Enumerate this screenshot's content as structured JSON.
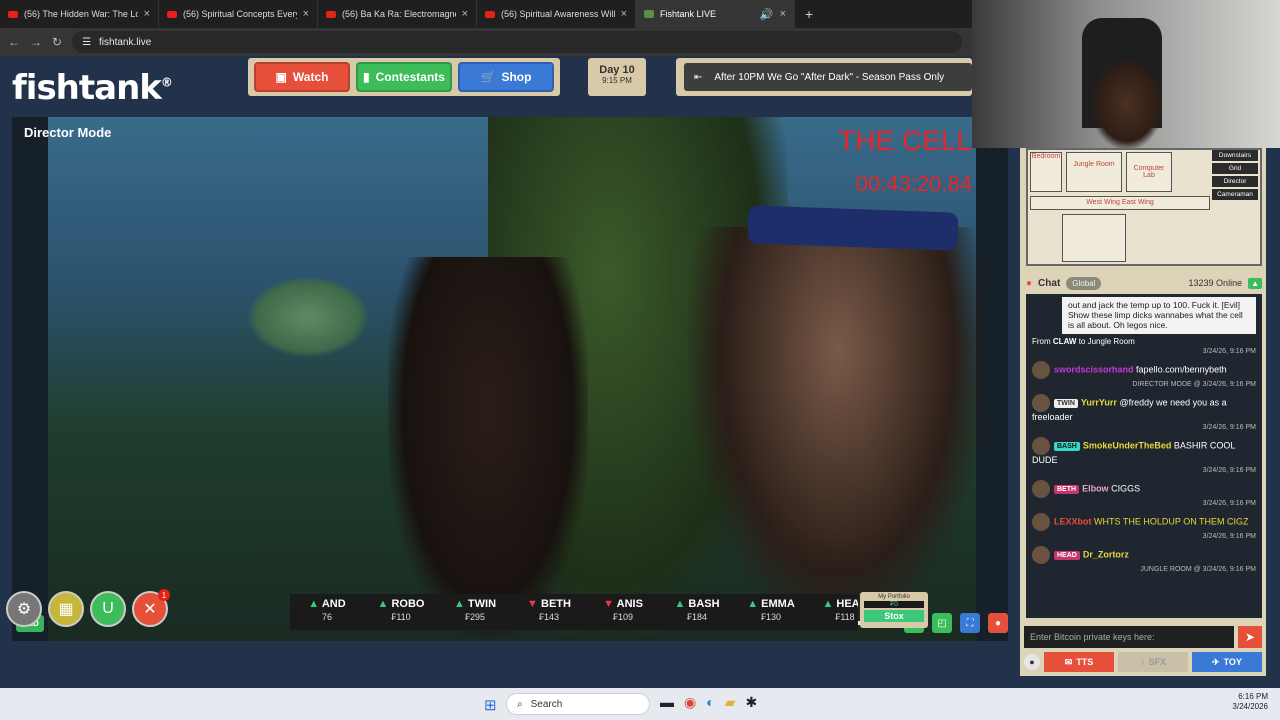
{
  "browser": {
    "tabs": [
      {
        "title": "(56) The Hidden War: The Loo",
        "type": "youtube",
        "active": false
      },
      {
        "title": "(56) Spiritual Concepts Everyon",
        "type": "youtube",
        "active": false
      },
      {
        "title": "(56) Ba Ka Ra: Electromagnetic",
        "type": "youtube",
        "active": false
      },
      {
        "title": "(56) Spiritual Awareness Will R",
        "type": "youtube",
        "active": false
      },
      {
        "title": "Fishtank LIVE",
        "type": "fishtank",
        "active": true
      }
    ],
    "new_tab": "+",
    "url": "fishtank.live"
  },
  "site": {
    "logo": "fishtank",
    "logo_mark": "®",
    "nav": {
      "watch": "Watch",
      "contestants": "Contestants",
      "shop": "Shop"
    },
    "day": "Day 10",
    "time": "9:15 PM",
    "announcement": "After 10PM We Go \"After Dark\" - Season Pass Only"
  },
  "video": {
    "mode": "Director Mode",
    "room": "THE CELL",
    "timer": "00:43:20.84",
    "quality": "MED",
    "volume_level": 0.38
  },
  "ticker": [
    {
      "name": "AND",
      "price": "76",
      "dir": "up"
    },
    {
      "name": "ROBO",
      "price": "₣110",
      "dir": "up"
    },
    {
      "name": "TWIN",
      "price": "₣295",
      "dir": "up"
    },
    {
      "name": "BETH",
      "price": "₣143",
      "dir": "dn"
    },
    {
      "name": "ANIS",
      "price": "₣109",
      "dir": "dn"
    },
    {
      "name": "BASH",
      "price": "₣184",
      "dir": "up"
    },
    {
      "name": "EMMA",
      "price": "₣130",
      "dir": "up"
    },
    {
      "name": "HEAD",
      "price": "₣118",
      "dir": "up"
    }
  ],
  "portfolio": {
    "label": "My Portfolio",
    "value": "₣0",
    "button": "Stox"
  },
  "tools": {
    "badge": "1"
  },
  "map": {
    "rooms": {
      "bedroom": "Bedroom",
      "jungle": "Jungle Room",
      "computer": "Computer Lab",
      "corridor": "Corridor",
      "west": "West Wing",
      "east": "East Wing"
    },
    "menu": [
      "Downstairs",
      "Grid",
      "Director",
      "Cameraman"
    ]
  },
  "chat": {
    "title": "Chat",
    "tab": "Global",
    "online": "13239 Online",
    "messages": [
      {
        "kind": "bubble",
        "text": "out and jack the temp up to 100. Fuck it. [Evil] Show these limp dicks wannabes what the cell is all about. Oh legos nice.",
        "from_label": "From",
        "from_user": "CLAW",
        "to_label": "to",
        "to_room": "Jungle Room",
        "time": "3/24/26, 9:16 PM"
      },
      {
        "kind": "msg",
        "user": "swordscissorhand",
        "color": "#c63bd6",
        "text": "fapello.com/bennybeth",
        "meta": "DIRECTOR MODE @ 3/24/26, 9:16 PM"
      },
      {
        "kind": "msg",
        "tag": "TWIN",
        "tagcolor": "#eee",
        "tagtext": "#333",
        "user": "YurrYurr",
        "color": "#e6d93a",
        "text": "@freddy we need you as a freeloader",
        "meta": "3/24/26, 9:16 PM"
      },
      {
        "kind": "msg",
        "tag": "BASH",
        "tagcolor": "#3ad6c6",
        "tagtext": "#111",
        "user": "SmokeUnderTheBed",
        "color": "#e6d93a",
        "text": "BASHIR COOL DUDE",
        "meta": "3/24/26, 9:16 PM"
      },
      {
        "kind": "msg",
        "tag": "BETH",
        "tagcolor": "#c6366a",
        "tagtext": "#fff",
        "user": "Elbow",
        "color": "#e6a6c6",
        "text": "CIGGS",
        "meta": "3/24/26, 9:16 PM"
      },
      {
        "kind": "msg",
        "user": "LEXXbot",
        "color": "#e6503a",
        "text": "WHTS THE HOLDUP ON THEM CIGZ",
        "textcolor": "#e6d93a",
        "meta": "3/24/26, 9:16 PM"
      },
      {
        "kind": "msg",
        "tag": "HEAD",
        "tagcolor": "#c6366a",
        "tagtext": "#fff",
        "user": "Dr_Zortorz",
        "color": "#e6d93a",
        "text": "",
        "meta": "JUNGLE ROOM @ 3/24/26, 9:16 PM"
      }
    ],
    "input_placeholder": "Enter Bitcoin private keys here:",
    "buttons": {
      "tts": "TTS",
      "sfx": "SFX",
      "toy": "TOY"
    }
  },
  "taskbar": {
    "search": "Search",
    "time": "6:16 PM",
    "date": "3/24/2026"
  },
  "colors": {
    "watch": "#e6503a",
    "contestants": "#3cbd5a",
    "shop": "#3a7ad6",
    "accent_red": "#e6262a"
  }
}
